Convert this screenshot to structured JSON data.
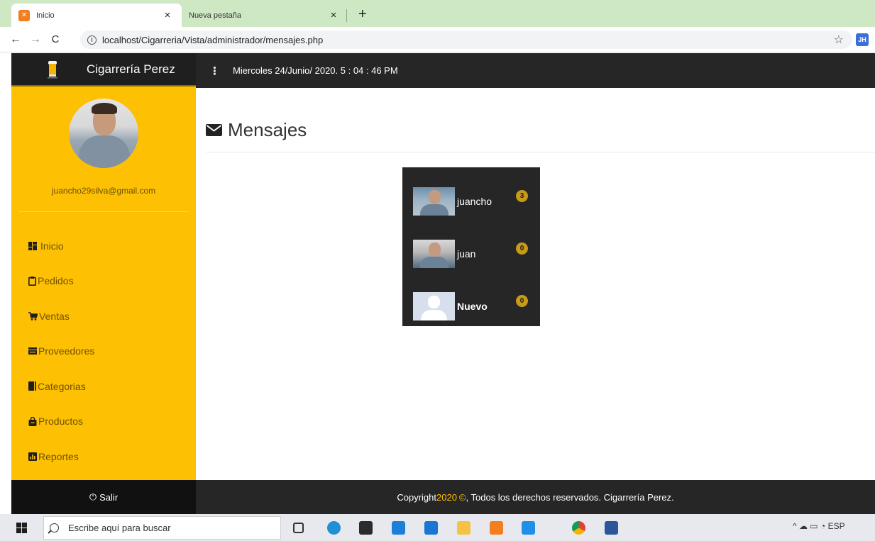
{
  "browser": {
    "tabs": [
      {
        "title": "Inicio",
        "active": true,
        "favicon": "xampp-icon"
      },
      {
        "title": "Nueva pestaña",
        "active": false
      }
    ],
    "close_glyph": "×",
    "new_tab_glyph": "+",
    "url": "localhost/Cigarreria/Vista/administrador/mensajes.php",
    "profile_initials": "JH"
  },
  "app": {
    "brand": "Cigarrería Perez",
    "datetime": "Miercoles 24/Junio/ 2020. 5 : 04 : 46 PM",
    "user_email": "juancho29silva@gmail.com",
    "nav": [
      {
        "label": "Inicio",
        "icon": "dashboard-icon"
      },
      {
        "label": "Pedidos",
        "icon": "clipboard-icon"
      },
      {
        "label": "Ventas",
        "icon": "cart-icon"
      },
      {
        "label": "Proveedores",
        "icon": "truck-icon"
      },
      {
        "label": "Categorias",
        "icon": "book-icon"
      },
      {
        "label": "Productos",
        "icon": "bag-icon"
      },
      {
        "label": "Reportes",
        "icon": "chart-icon"
      }
    ],
    "page_title": "Mensajes",
    "messages": [
      {
        "name": "juancho",
        "count": "3"
      },
      {
        "name": "juan",
        "count": "0"
      },
      {
        "name": "Nuevo",
        "count": "0"
      }
    ],
    "logout_label": "Salir",
    "footer": {
      "prefix": "Copyright ",
      "year": "2020",
      "copyright_glyph": "©",
      "suffix": ", Todos los derechos reservados. Cigarrería Perez."
    },
    "colors": {
      "accent": "#fec002",
      "dark": "#262626",
      "badge": "#c89a18"
    }
  },
  "taskbar": {
    "search_placeholder": "Escribe aquí para buscar",
    "tray_text": "ESP"
  }
}
